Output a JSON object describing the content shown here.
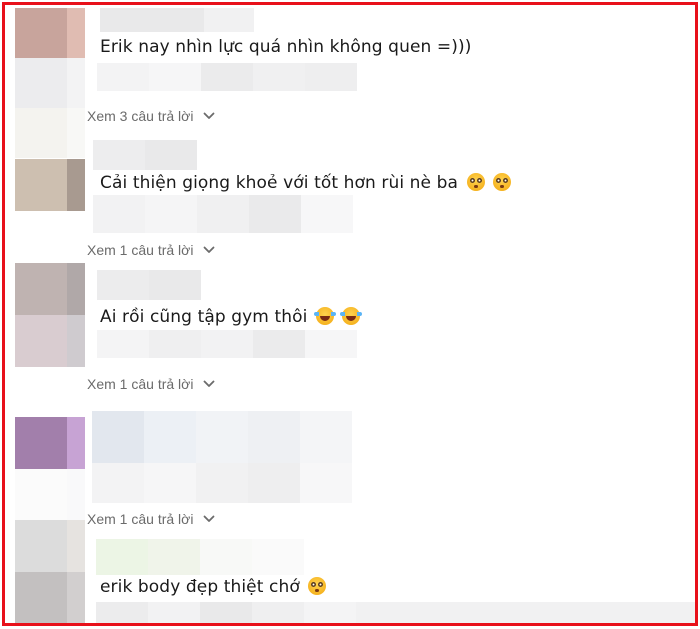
{
  "comments": [
    {
      "text": "Erik nay nhìn lực quá nhìn không quen =)))",
      "emoji": []
    },
    {
      "text": "Cải thiện giọng khoẻ với tốt hơn rùi nè ba",
      "emoji": [
        "flushed-face",
        "flushed-face"
      ]
    },
    {
      "text": "Ai rồi cũng tập gym thôi",
      "emoji": [
        "laughing-tears-face",
        "laughing-tears-face"
      ]
    },
    {
      "text": "erik body đẹp thiệt chớ",
      "emoji": [
        "flushed-face"
      ]
    }
  ],
  "replies": [
    {
      "label": "Xem 3 câu trả lời"
    },
    {
      "label": "Xem 1 câu trả lời"
    },
    {
      "label": "Xem 1 câu trả lời"
    },
    {
      "label": "Xem 1 câu trả lời"
    }
  ],
  "colors": {
    "border": "#e8101a",
    "text": "#1a1a1a",
    "reply": "#6b6b6b"
  }
}
